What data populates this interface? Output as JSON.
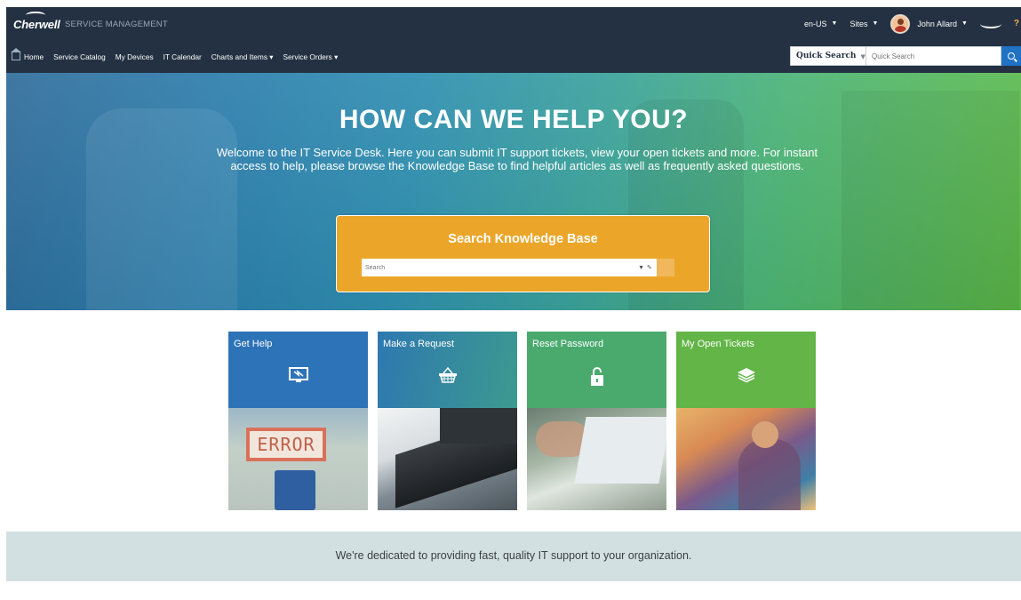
{
  "header": {
    "logo": "Cherwell",
    "product": "SERVICE MANAGEMENT",
    "locale": "en-US",
    "sites": "Sites",
    "user": "John Allard",
    "help": "?"
  },
  "nav": {
    "items": [
      {
        "label": "Home"
      },
      {
        "label": "Service Catalog"
      },
      {
        "label": "My Devices"
      },
      {
        "label": "IT Calendar"
      },
      {
        "label": "Charts and Items ▾"
      },
      {
        "label": "Service Orders ▾"
      }
    ]
  },
  "quick_search": {
    "select_label": "Quick Search",
    "placeholder": "Quick Search"
  },
  "hero": {
    "title": "HOW CAN WE HELP YOU?",
    "text": "Welcome to the IT Service Desk.  Here you can submit IT support tickets, view your open tickets and more. For instant access to help, please browse the Knowledge Base to find helpful articles as well as frequently asked questions."
  },
  "kb": {
    "title": "Search Knowledge Base",
    "placeholder": "Search"
  },
  "tiles": [
    {
      "label": "Get Help",
      "icon": "monitor-icon",
      "image_text": "ERROR"
    },
    {
      "label": "Make a Request",
      "icon": "basket-icon"
    },
    {
      "label": "Reset Password",
      "icon": "lock-icon"
    },
    {
      "label": "My Open Tickets",
      "icon": "layers-icon"
    }
  ],
  "footer": {
    "text": "We're dedicated to providing fast, quality IT support to your organization."
  },
  "colors": {
    "header_bg": "#243142",
    "kb_bg": "#eba62a",
    "tile_blue": "#2d73b7",
    "tile_green": "#62b546",
    "band_bg": "#d3e0e1"
  }
}
